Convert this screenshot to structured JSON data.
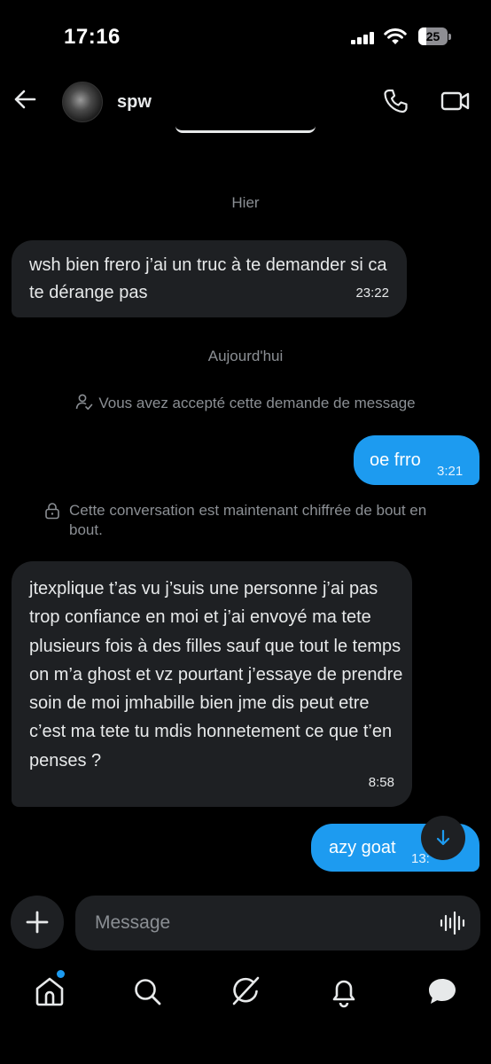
{
  "status_bar": {
    "time": "17:16",
    "battery": "25"
  },
  "header": {
    "contact_name": "spw"
  },
  "chat": {
    "date_yesterday": "Hier",
    "msg1": {
      "text": "wsh bien frero j’ai un truc à te demander si ca te dérange pas",
      "time": "23:22"
    },
    "date_today": "Aujourd'hui",
    "request_notice": "Vous avez accepté cette demande de message",
    "msg2": {
      "text": "oe frro",
      "time": "3:21"
    },
    "encryption_notice": "Cette conversation est maintenant chiffrée de bout en bout.",
    "msg3": {
      "text": "jtexplique t’as vu j’suis une personne j’ai pas trop confiance en moi et j’ai envoyé ma tete plusieurs fois à des filles sauf que tout le temps on m’a ghost et vz pourtant j’essaye de prendre soin de moi jmhabille bien jme dis peut etre c’est ma tete tu mdis honnetement ce que t’en penses ?",
      "time": "8:58"
    },
    "msg4": {
      "text": "azy goat",
      "time": "13:"
    }
  },
  "composer": {
    "placeholder": "Message"
  },
  "icons": {
    "back": "arrow-left-icon",
    "call": "phone-icon",
    "video": "video-camera-icon",
    "add": "plus-icon",
    "voice": "waveform-icon",
    "scroll": "arrow-down-icon",
    "nav": [
      "home-icon",
      "search-icon",
      "grok-icon",
      "bell-icon",
      "messages-icon"
    ]
  },
  "colors": {
    "accent": "#1d9bf0",
    "incoming_bubble": "#1e2023",
    "background": "#000000",
    "muted_text": "#8b8f94"
  }
}
